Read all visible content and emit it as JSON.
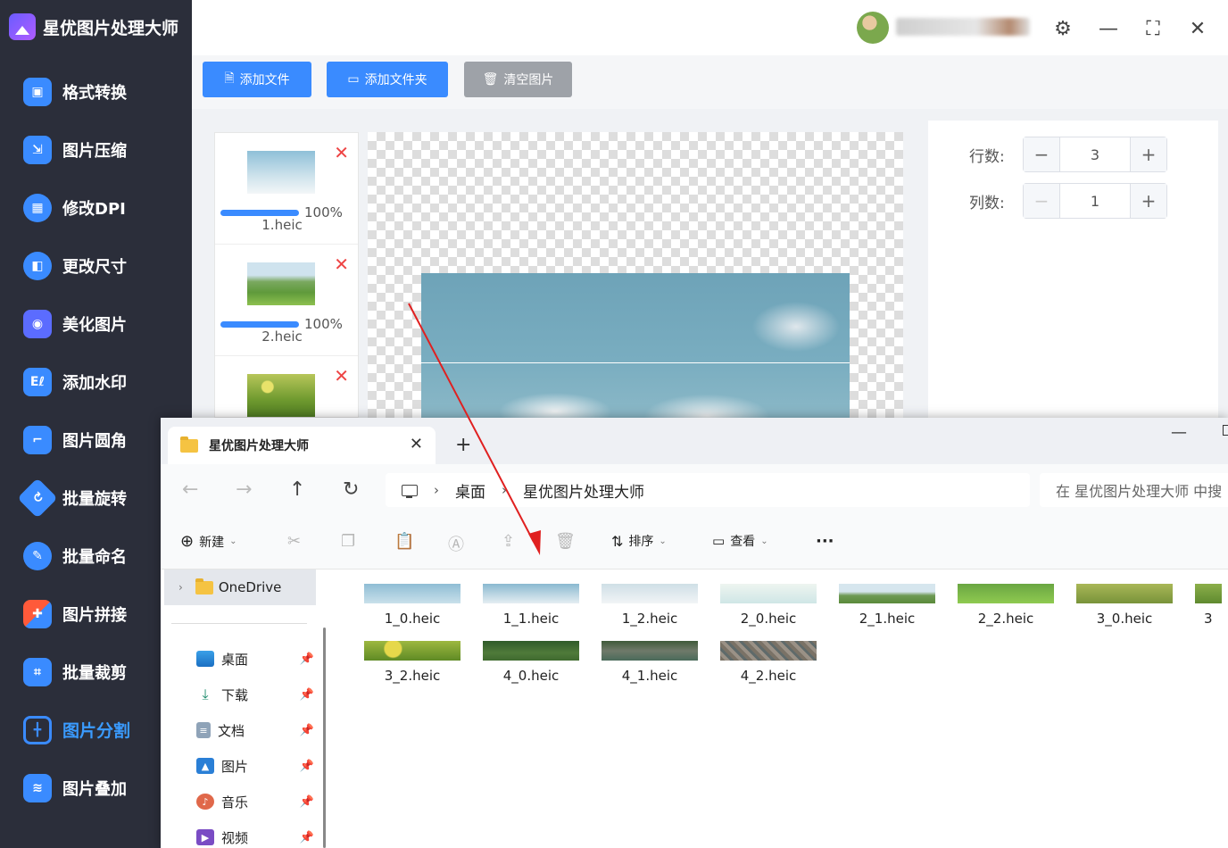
{
  "app": {
    "title": "星优图片处理大师",
    "nav": [
      {
        "label": "格式转换",
        "icon": "image-convert-icon",
        "color": "#3a8bff"
      },
      {
        "label": "图片压缩",
        "icon": "compress-icon",
        "color": "#3a8bff"
      },
      {
        "label": "修改DPI",
        "icon": "dpi-icon",
        "color": "#3a8bff"
      },
      {
        "label": "更改尺寸",
        "icon": "resize-icon",
        "color": "#3a8bff"
      },
      {
        "label": "美化图片",
        "icon": "beautify-icon",
        "color": "#3a8bff"
      },
      {
        "label": "添加水印",
        "icon": "watermark-icon",
        "color": "#3a8bff"
      },
      {
        "label": "图片圆角",
        "icon": "rounded-corner-icon",
        "color": "#3a8bff"
      },
      {
        "label": "批量旋转",
        "icon": "rotate-icon",
        "color": "#3a8bff"
      },
      {
        "label": "批量命名",
        "icon": "rename-icon",
        "color": "#3a8bff"
      },
      {
        "label": "图片拼接",
        "icon": "puzzle-icon",
        "color": "#ff5a3a"
      },
      {
        "label": "批量裁剪",
        "icon": "crop-icon",
        "color": "#3a8bff"
      },
      {
        "label": "图片分割",
        "icon": "split-icon",
        "color": "#3a8bff"
      },
      {
        "label": "图片叠加",
        "icon": "layers-icon",
        "color": "#3a8bff"
      }
    ],
    "active_nav": "图片分割",
    "toolbar": {
      "add_file": "添加文件",
      "add_folder": "添加文件夹",
      "clear": "清空图片"
    },
    "files": [
      {
        "name": "1.heic",
        "progress": "100%"
      },
      {
        "name": "2.heic",
        "progress": "100%"
      },
      {
        "name": "",
        "progress": ""
      }
    ],
    "settings": {
      "rows_label": "行数:",
      "rows_value": "3",
      "cols_label": "列数:",
      "cols_value": "1"
    },
    "colors": {
      "accent": "#3a8bff",
      "sidebar": "#2b2e3a",
      "danger": "#e44444"
    }
  },
  "explorer": {
    "tab_title": "星优图片处理大师",
    "breadcrumb": [
      "桌面",
      "星优图片处理大师"
    ],
    "search_placeholder": "在 星优图片处理大师 中搜",
    "commands": {
      "new": "新建",
      "sort": "排序",
      "view": "查看",
      "more": "···"
    },
    "sidebar": {
      "onedrive": "OneDrive",
      "items": [
        {
          "label": "桌面",
          "icon": "desktop-icon"
        },
        {
          "label": "下载",
          "icon": "download-icon"
        },
        {
          "label": "文档",
          "icon": "document-icon"
        },
        {
          "label": "图片",
          "icon": "pictures-icon"
        },
        {
          "label": "音乐",
          "icon": "music-icon"
        },
        {
          "label": "视频",
          "icon": "video-icon"
        }
      ]
    },
    "files": [
      "1_0.heic",
      "1_1.heic",
      "1_2.heic",
      "2_0.heic",
      "2_1.heic",
      "2_2.heic",
      "3_0.heic",
      "3",
      "3_2.heic",
      "4_0.heic",
      "4_1.heic",
      "4_2.heic"
    ]
  }
}
